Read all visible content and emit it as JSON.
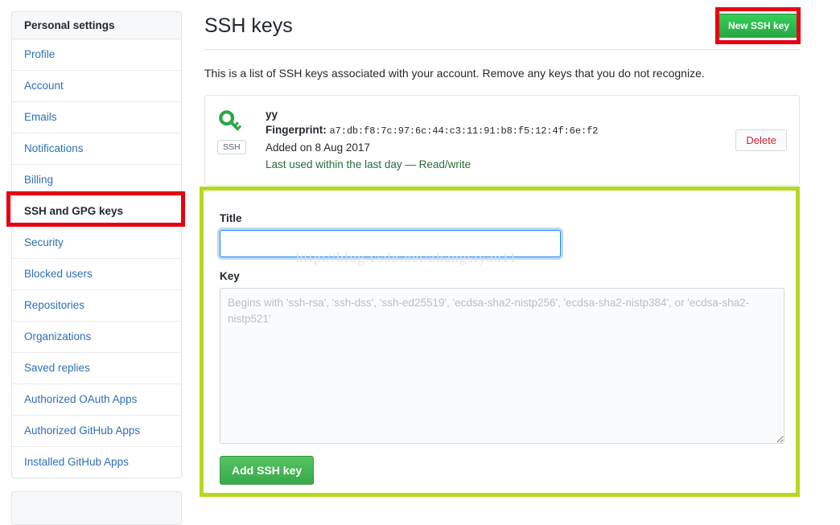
{
  "sidebar": {
    "heading": "Personal settings",
    "items": [
      {
        "label": "Profile",
        "selected": false
      },
      {
        "label": "Account",
        "selected": false
      },
      {
        "label": "Emails",
        "selected": false
      },
      {
        "label": "Notifications",
        "selected": false
      },
      {
        "label": "Billing",
        "selected": false
      },
      {
        "label": "SSH and GPG keys",
        "selected": true
      },
      {
        "label": "Security",
        "selected": false
      },
      {
        "label": "Blocked users",
        "selected": false
      },
      {
        "label": "Repositories",
        "selected": false
      },
      {
        "label": "Organizations",
        "selected": false
      },
      {
        "label": "Saved replies",
        "selected": false
      },
      {
        "label": "Authorized OAuth Apps",
        "selected": false
      },
      {
        "label": "Authorized GitHub Apps",
        "selected": false
      },
      {
        "label": "Installed GitHub Apps",
        "selected": false
      }
    ]
  },
  "main": {
    "title": "SSH keys",
    "new_key_button": "New SSH key",
    "description": "This is a list of SSH keys associated with your account. Remove any keys that you do not recognize."
  },
  "key_card": {
    "icon": "key-icon",
    "badge": "SSH",
    "name": "yy",
    "fingerprint_label": "Fingerprint:",
    "fingerprint_value": "a7:db:f8:7c:97:6c:44:c3:11:91:b8:f5:12:4f:6e:f2",
    "added_on": "Added on 8 Aug 2017",
    "last_used": "Last used within the last day — Read/write",
    "delete_button": "Delete"
  },
  "form": {
    "title_label": "Title",
    "title_value": "",
    "title_placeholder": "",
    "key_label": "Key",
    "key_value": "",
    "key_placeholder": "Begins with 'ssh-rsa', 'ssh-dss', 'ssh-ed25519', 'ecdsa-sha2-nistp256', 'ecdsa-sha2-nistp384', or 'ecdsa-sha2-nistp521'",
    "submit_button": "Add SSH key"
  },
  "watermark": {
    "text": "http://blog.csdn.net/zhangsiyao11"
  },
  "colors": {
    "green_button": "#28a745",
    "link_blue": "#2f6fb3",
    "delete_red": "#cb2431",
    "last_used_green": "#2a6b37",
    "annotation_red": "#e60012",
    "annotation_green": "#b5d921",
    "focus_blue": "#2188ff"
  }
}
